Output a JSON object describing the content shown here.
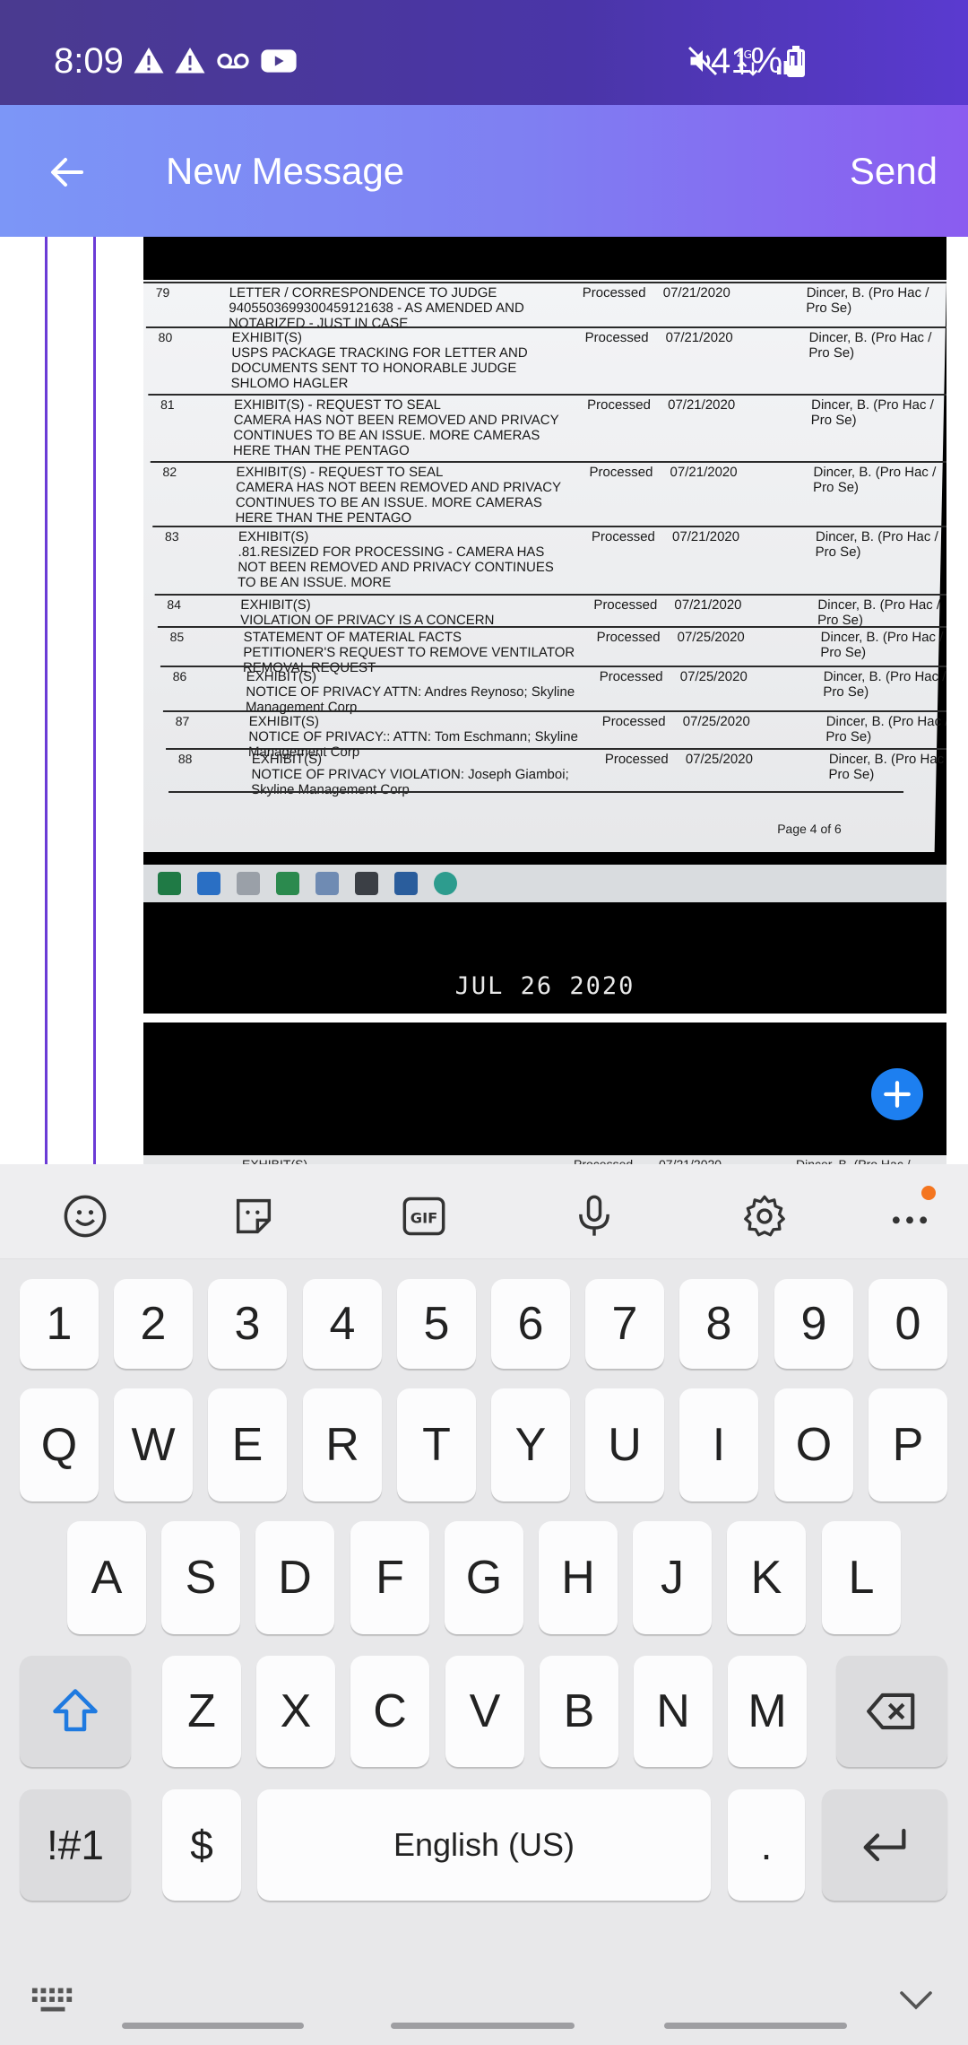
{
  "status_bar": {
    "time": "8:09",
    "battery_percent": "41%",
    "battery_level": 0.41
  },
  "header": {
    "title": "New Message",
    "send_label": "Send",
    "colors": {
      "gradient_start": "#7c96f7",
      "gradient_end": "#8a5cf0"
    }
  },
  "attachment": {
    "rows": [
      {
        "num": "79",
        "desc": "LETTER / CORRESPONDENCE TO JUDGE\n9405503699300459121638 - AS AMENDED AND\nNOTARIZED - JUST IN CASE",
        "status": "Processed",
        "date": "07/21/2020",
        "filer": "Dincer, B. (Pro Hac /\nPro Se)"
      },
      {
        "num": "80",
        "desc": "EXHIBIT(S)\nUSPS PACKAGE TRACKING FOR LETTER AND\nDOCUMENTS SENT TO HONORABLE JUDGE\nSHLOMO HAGLER",
        "status": "Processed",
        "date": "07/21/2020",
        "filer": "Dincer, B. (Pro Hac /\nPro Se)"
      },
      {
        "num": "81",
        "desc": "EXHIBIT(S) - REQUEST TO SEAL\nCAMERA HAS NOT BEEN REMOVED AND PRIVACY\nCONTINUES TO BE AN ISSUE. MORE CAMERAS\nHERE THAN THE PENTAGO",
        "status": "Processed",
        "date": "07/21/2020",
        "filer": "Dincer, B. (Pro Hac /\nPro Se)"
      },
      {
        "num": "82",
        "desc": "EXHIBIT(S) - REQUEST TO SEAL\nCAMERA HAS NOT BEEN REMOVED AND PRIVACY\nCONTINUES TO BE AN ISSUE. MORE CAMERAS\nHERE THAN THE PENTAGO",
        "status": "Processed",
        "date": "07/21/2020",
        "filer": "Dincer, B. (Pro Hac /\nPro Se)"
      },
      {
        "num": "83",
        "desc": "EXHIBIT(S)\n.81.RESIZED FOR PROCESSING - CAMERA HAS\nNOT BEEN REMOVED AND PRIVACY CONTINUES\nTO BE AN ISSUE. MORE",
        "status": "Processed",
        "date": "07/21/2020",
        "filer": "Dincer, B. (Pro Hac /\nPro Se)"
      },
      {
        "num": "84",
        "desc": "EXHIBIT(S)\nVIOLATION OF PRIVACY IS A CONCERN",
        "status": "Processed",
        "date": "07/21/2020",
        "filer": "Dincer, B. (Pro Hac /\nPro Se)"
      },
      {
        "num": "85",
        "desc": "STATEMENT OF MATERIAL FACTS\nPETITIONER'S REQUEST TO REMOVE VENTILATOR\nREMOVAL REQUEST",
        "status": "Processed",
        "date": "07/25/2020",
        "filer": "Dincer, B. (Pro Hac /\nPro Se)"
      },
      {
        "num": "86",
        "desc": "EXHIBIT(S)\nNOTICE OF PRIVACY ATTN: Andres Reynoso; Skyline\nManagement Corp",
        "status": "Processed",
        "date": "07/25/2020",
        "filer": "Dincer, B. (Pro Hac /\nPro Se)"
      },
      {
        "num": "87",
        "desc": "EXHIBIT(S)\nNOTICE OF PRIVACY:: ATTN: Tom Eschmann; Skyline\nManagement Corp",
        "status": "Processed",
        "date": "07/25/2020",
        "filer": "Dincer, B. (Pro Hac /\nPro Se)"
      },
      {
        "num": "88",
        "desc": "EXHIBIT(S)\nNOTICE OF PRIVACY VIOLATION: Joseph Giamboi;\nSkyline Management Corp",
        "status": "Processed",
        "date": "07/25/2020",
        "filer": "Dincer, B. (Pro Hac /\nPro Se)"
      }
    ],
    "page_label": "Page 4 of 6",
    "photo_date": "JUL 26 2020",
    "second_photo_strip": {
      "desc": "EXHIBIT(S)",
      "status": "Processed",
      "date": "07/21/2020",
      "filer": "Dincer, B. (Pro Hac /"
    }
  },
  "keyboard": {
    "number_row": [
      "1",
      "2",
      "3",
      "4",
      "5",
      "6",
      "7",
      "8",
      "9",
      "0"
    ],
    "row1": [
      "Q",
      "W",
      "E",
      "R",
      "T",
      "Y",
      "U",
      "I",
      "O",
      "P"
    ],
    "row2": [
      "A",
      "S",
      "D",
      "F",
      "G",
      "H",
      "J",
      "K",
      "L"
    ],
    "row3": [
      "Z",
      "X",
      "C",
      "V",
      "B",
      "N",
      "M"
    ],
    "symbols_label": "!#1",
    "currency_label": "$",
    "space_label": "English (US)",
    "period_label": ".",
    "toolbar_icons": [
      "emoji-icon",
      "sticker-icon",
      "gif-icon",
      "mic-icon",
      "gear-icon",
      "more-icon"
    ],
    "gif_label": "GIF"
  },
  "colors": {
    "accent": "#6b3bd6",
    "fab": "#1d7ff0",
    "shift_blue": "#1f7ae0",
    "notification": "#f4751f"
  }
}
